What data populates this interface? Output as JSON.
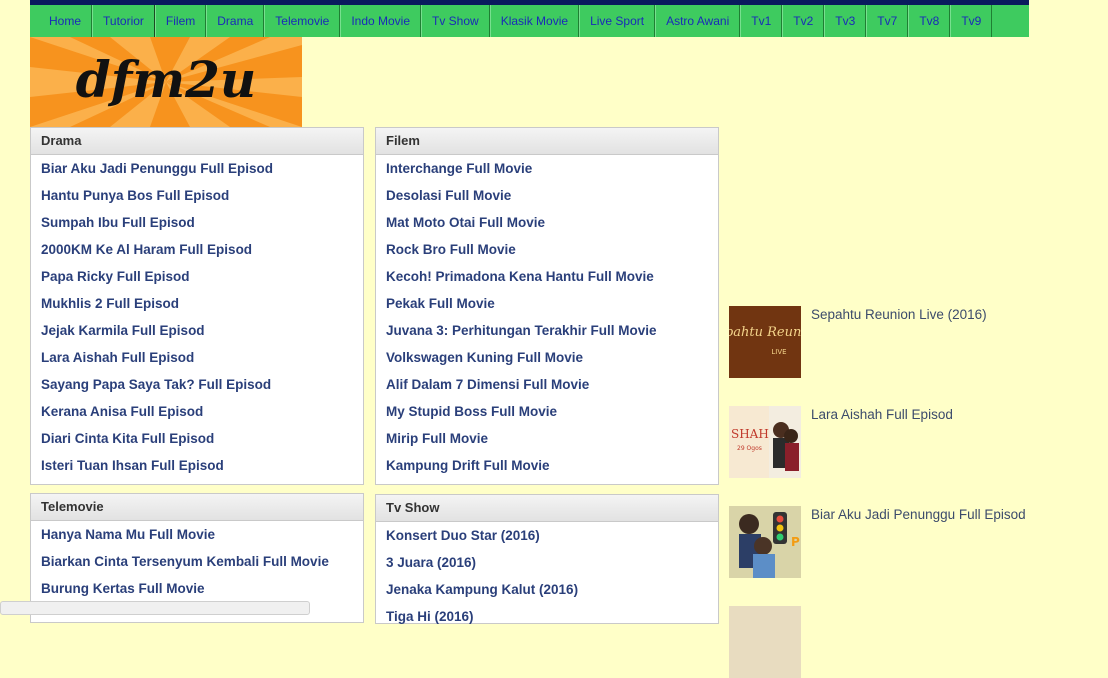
{
  "nav": {
    "items": [
      "Home",
      "Tutorior",
      "Filem",
      "Drama",
      "Telemovie",
      "Indo Movie",
      "Tv Show",
      "Klasik Movie",
      "Live Sport",
      "Astro Awani",
      "Tv1",
      "Tv2",
      "Tv3",
      "Tv7",
      "Tv8",
      "Tv9"
    ]
  },
  "logo": {
    "text": "dfm2u"
  },
  "drama": {
    "title": "Drama",
    "items": [
      "Biar Aku Jadi Penunggu Full Episod",
      "Hantu Punya Bos Full Episod",
      "Sumpah Ibu Full Episod",
      "2000KM Ke Al Haram Full Episod",
      "Papa Ricky Full Episod",
      "Mukhlis 2 Full Episod",
      "Jejak Karmila Full Episod",
      "Lara Aishah Full Episod",
      "Sayang Papa Saya Tak? Full Episod",
      "Kerana Anisa Full Episod",
      "Diari Cinta Kita Full Episod",
      "Isteri Tuan Ihsan Full Episod"
    ]
  },
  "filem": {
    "title": "Filem",
    "items": [
      "Interchange Full Movie",
      "Desolasi Full Movie",
      "Mat Moto Otai Full Movie",
      "Rock Bro Full Movie",
      "Kecoh! Primadona Kena Hantu Full Movie",
      "Pekak Full Movie",
      "Juvana 3: Perhitungan Terakhir Full Movie",
      "Volkswagen Kuning Full Movie",
      "Alif Dalam 7 Dimensi Full Movie",
      "My Stupid Boss Full Movie",
      "Mirip Full Movie",
      "Kampung Drift Full Movie"
    ]
  },
  "telemovie": {
    "title": "Telemovie",
    "items": [
      "Hanya Nama Mu Full Movie",
      "Biarkan Cinta Tersenyum Kembali Full Movie",
      "Burung Kertas Full Movie"
    ]
  },
  "tvshow": {
    "title": "Tv Show",
    "items": [
      "Konsert Duo Star (2016)",
      "3 Juara (2016)",
      "Jenaka Kampung Kalut (2016)",
      "Tiga Hi (2016)"
    ]
  },
  "sidebar": {
    "items": [
      {
        "title": "Sepahtu Reunion Live (2016)",
        "thumb_text": "Sepahtu Reunion",
        "thumb_sub": "LIVE"
      },
      {
        "title": "Lara Aishah Full Episod",
        "thumb_text": "SHAH",
        "thumb_sub": "29 Ogos"
      },
      {
        "title": "Biar Aku Jadi Penunggu Full Episod"
      }
    ]
  },
  "colors": {
    "background": "#ffffc8",
    "nav_bg": "#3ecb5f",
    "nav_text": "#1a2bb8",
    "link": "#2a3f7a",
    "logo_orange": "#f7931e"
  }
}
